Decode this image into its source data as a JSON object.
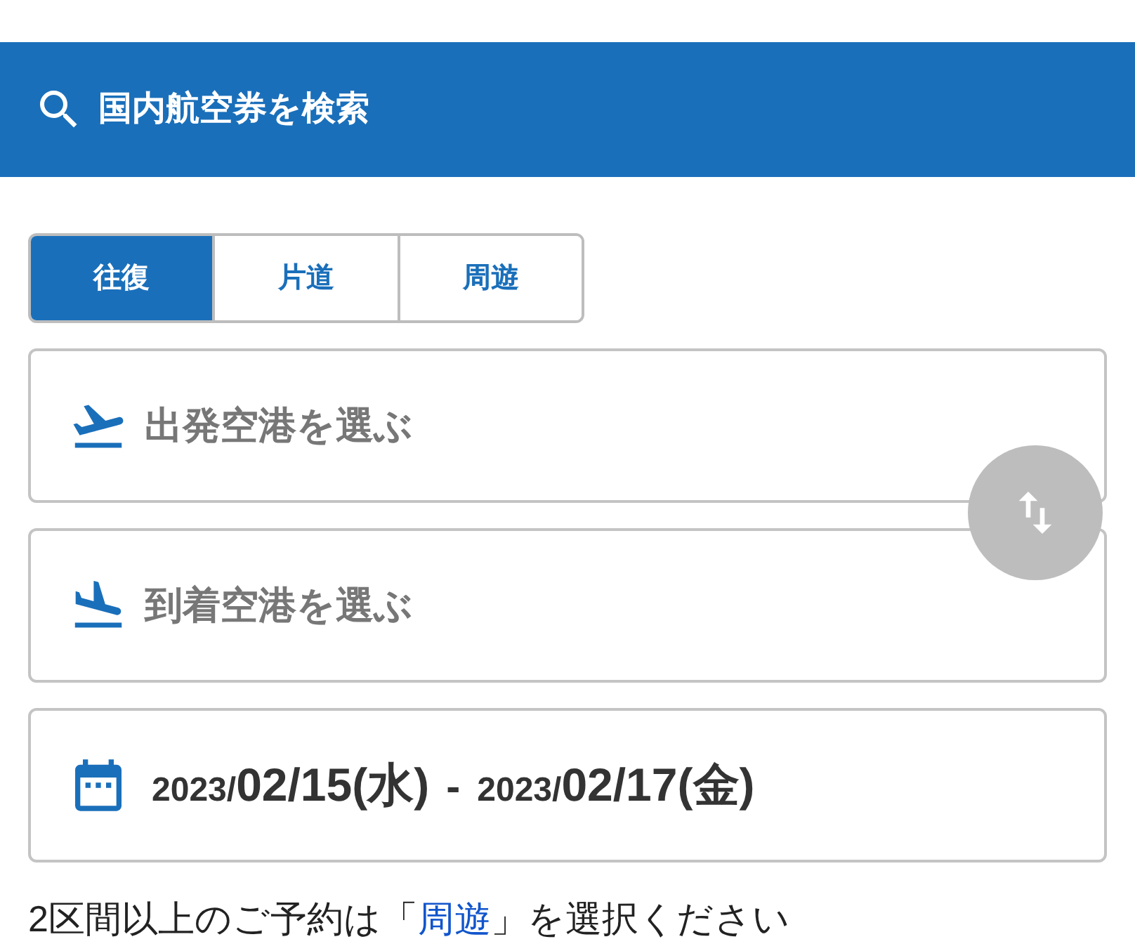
{
  "header": {
    "title": "国内航空券を検索"
  },
  "trip_tabs": [
    {
      "label": "往復",
      "selected": true
    },
    {
      "label": "片道",
      "selected": false
    },
    {
      "label": "周遊",
      "selected": false
    }
  ],
  "airport_fields": [
    {
      "kind": "departure",
      "placeholder": "出発空港を選ぶ"
    },
    {
      "kind": "arrival",
      "placeholder": "到着空港を選ぶ"
    }
  ],
  "date_range": {
    "start": {
      "year": "2023/",
      "date": "02/15(水)"
    },
    "separator": "-",
    "end": {
      "year": "2023/",
      "date": "02/17(金)"
    }
  },
  "note": {
    "before": "2区間以上のご予約は「",
    "link": "周遊",
    "after": "」を選択ください"
  }
}
